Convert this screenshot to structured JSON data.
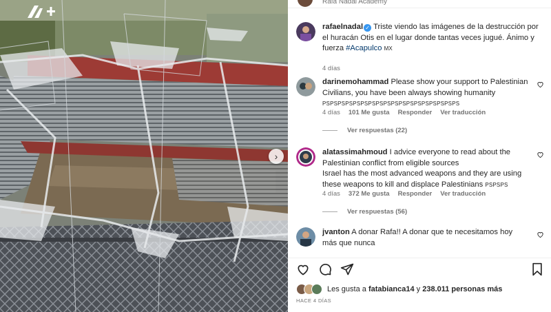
{
  "header": {
    "academy_text": "Rafa Nadal Academy"
  },
  "post": {
    "username": "rafaelnadal",
    "caption": "Triste viendo las imágenes de la destrucción por el huracán Otis en el lugar donde tantas veces jugué. Ánimo y fuerza ",
    "hashtag": "#Acapulco",
    "country_code": "MX",
    "time": "4 días"
  },
  "comments": [
    {
      "username": "darinemohammad",
      "text": "Please show your support to Palestinian Civilians, you have been always showing humanity ",
      "tail": "PSPSPSPSPSPSPSPSPSPSPSPSPSPSPSPSPSPS",
      "time": "4 días",
      "likes": "101 Me gusta",
      "reply": "Responder",
      "translate": "Ver traducción",
      "view_replies": "Ver respuestas (22)"
    },
    {
      "username": "alatassimahmoud",
      "text": "I advice everyone to read about the Palestinian conflict from eligible sources",
      "text2": "Israel has the most advanced weapons and they are using these weapons to kill and displace Palestinians ",
      "tail": "PSPSPS",
      "time": "4 días",
      "likes": "372 Me gusta",
      "reply": "Responder",
      "translate": "Ver traducción",
      "view_replies": "Ver respuestas (56)"
    },
    {
      "username": "jvanton",
      "text": "A donar Rafa!! A donar que te necesitamos hoy más que nunca"
    }
  ],
  "likes": {
    "prefix": "Les gusta a ",
    "user": "fatabianca14",
    "middle": " y ",
    "count": "238.011 personas más"
  },
  "date": "HACE 4 DÍAS",
  "icons": [
    "heart-icon",
    "comment-icon",
    "share-icon",
    "bookmark-icon",
    "next-arrow-icon"
  ],
  "colors": {
    "link": "#00376b",
    "verified": "#3897f0",
    "muted": "#737373"
  }
}
